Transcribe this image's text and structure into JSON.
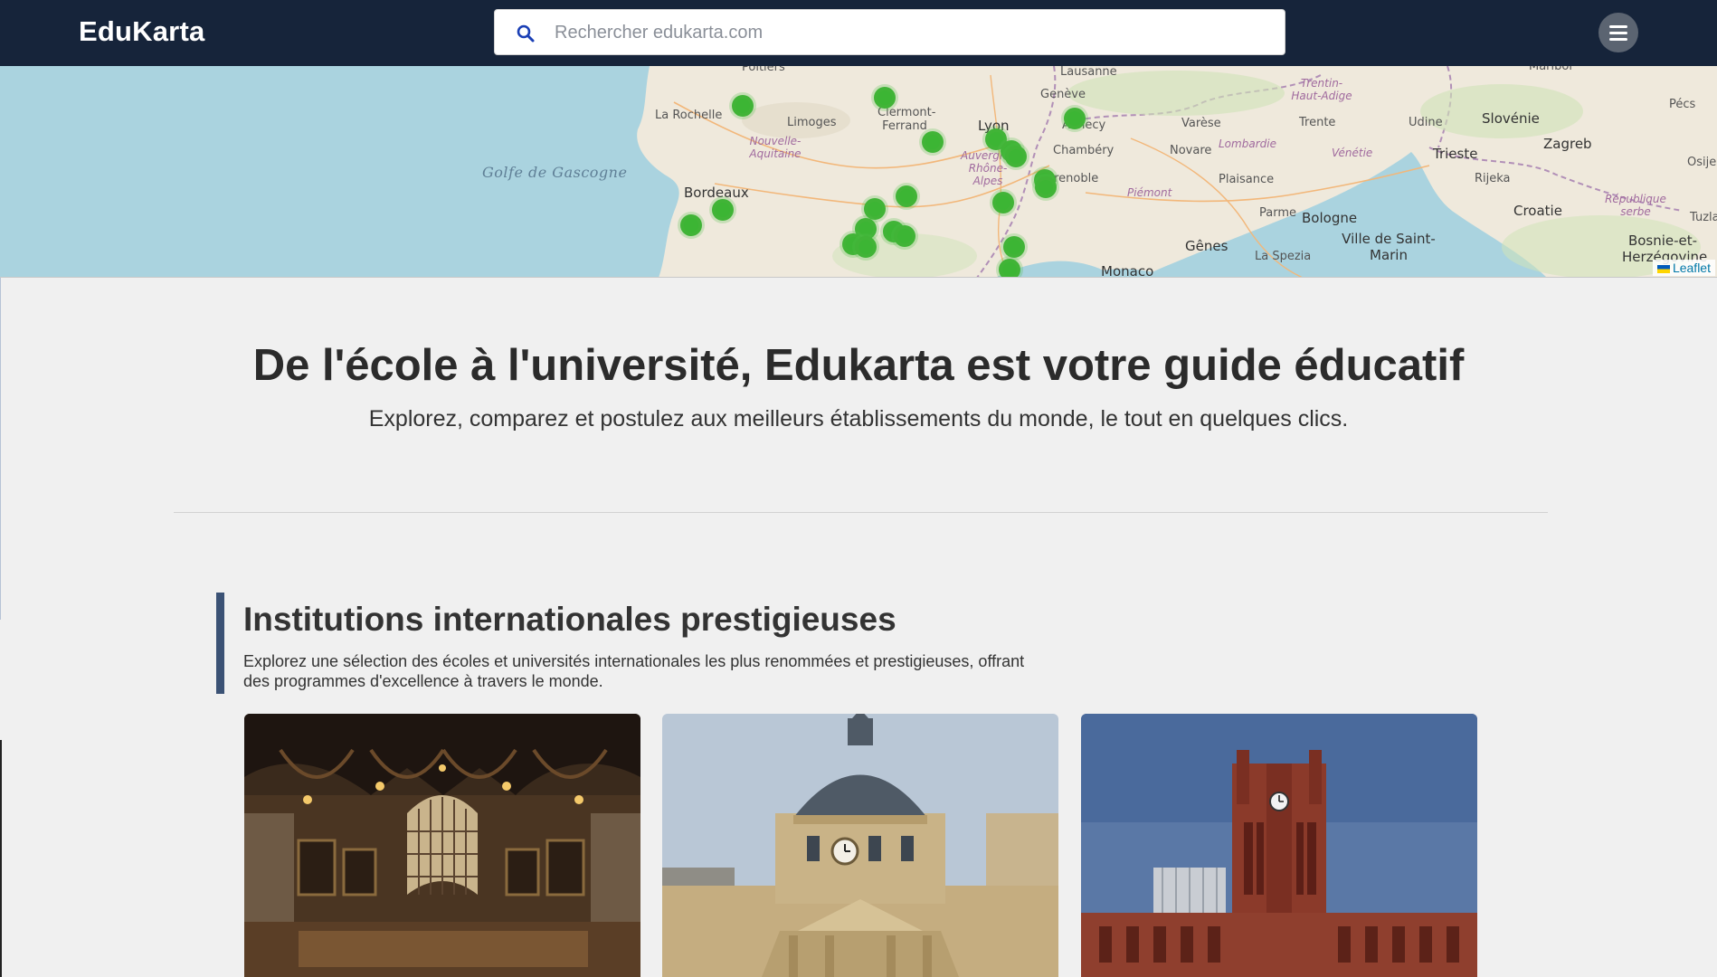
{
  "header": {
    "logo": "EduKarta",
    "search_placeholder": "Rechercher edukarta.com",
    "menu_icon": "hamburger-menu-icon"
  },
  "map": {
    "labels": {
      "poitiers": "Poitiers",
      "la_rochelle": "La Rochelle",
      "limoges": "Limoges",
      "nouvelle_aquitaine": "Nouvelle-Aquitaine",
      "golfe": "Golfe de Gascogne",
      "bordeaux": "Bordeaux",
      "clermont": "Clermont-Ferrand",
      "lyon": "Lyon",
      "auvergne": "Auvergne-Rhône-Alpes",
      "geneve": "Genève",
      "lausanne": "Lausanne",
      "annecy": "Annecy",
      "chambery": "Chambéry",
      "grenoble": "Grenoble",
      "piemont": "Piémont",
      "trentin": "Trentin-Haut-Adige",
      "trente": "Trente",
      "varese": "Varèse",
      "lombardie": "Lombardie",
      "novare": "Novare",
      "plaisance": "Plaisance",
      "venetie": "Vénétie",
      "udine": "Udine",
      "slovenie": "Slovénie",
      "zagreb": "Zagreb",
      "trieste": "Trieste",
      "rijeka": "Rijeka",
      "croatie": "Croatie",
      "parme": "Parme",
      "bologne": "Bologne",
      "genes": "Gênes",
      "la_spezia": "La Spezia",
      "monaco": "Monaco",
      "saint_marin": "Ville de Saint-Marin",
      "rep_serbe": "République serbe",
      "bosnie": "Bosnie-et-Herzégovine",
      "pecs": "Pécs",
      "maribor": "Maribor",
      "osije": "Osije",
      "tuzla": "Tuzla"
    },
    "marker_count": 21,
    "attribution": "Leaflet"
  },
  "hero": {
    "title": "De l'école à l'université, Edukarta est votre guide éducatif",
    "subtitle": "Explorez, comparez et postulez aux meilleurs établissements du monde, le tout en quelques clics."
  },
  "section": {
    "title": "Institutions internationales prestigieuses",
    "description": "Explorez une sélection des écoles et universités internationales les plus renommées et prestigieuses, offrant des programmes d'excellence à travers le monde."
  },
  "cards": [
    {
      "image": "gothic-great-hall-photo"
    },
    {
      "image": "domed-chapel-photo"
    },
    {
      "image": "red-brick-clock-tower-photo"
    }
  ]
}
